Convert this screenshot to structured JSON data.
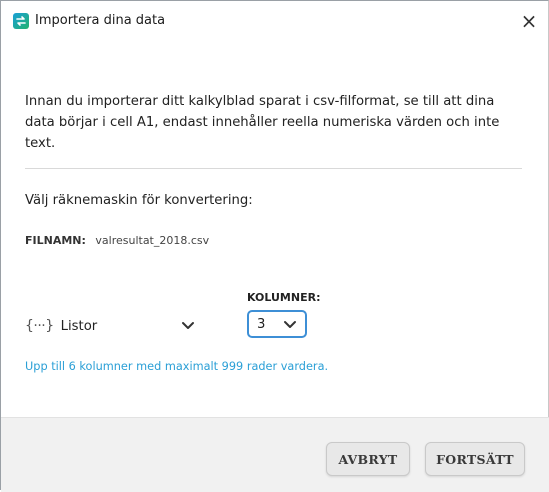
{
  "window": {
    "title": "Importera dina data",
    "close_glyph": "×"
  },
  "intro_text": "Innan du importerar ditt kalkylblad sparat i csv-filformat, se till att dina data börjar i cell A1, endast innehåller reella numeriska värden och inte text.",
  "calculator": {
    "label": "Välj räknemaskin för konvertering:",
    "selected_icon": "{···}",
    "selected": "Listor"
  },
  "file": {
    "key": "FILNAMN:",
    "name": "valresultat_2018.csv"
  },
  "columns": {
    "label": "KOLUMNER:",
    "value": "3"
  },
  "hint": "Upp till 6 kolumner med maximalt 999 rader vardera.",
  "buttons": {
    "cancel": "AVBRYT",
    "continue": "FORTSÄTT"
  },
  "colors": {
    "accent": "#2a9fd6",
    "focus_border": "#3d8fd6",
    "footer_bg": "#f1f1f1"
  }
}
